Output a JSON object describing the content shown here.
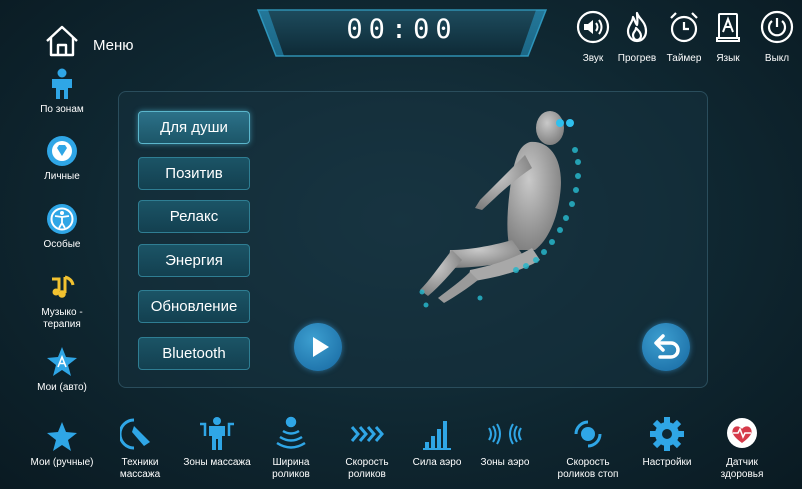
{
  "header": {
    "menu_label": "Меню",
    "timer": "00:00"
  },
  "top_tools": [
    {
      "label": "Звук",
      "icon": "speaker-icon"
    },
    {
      "label": "Прогрев",
      "icon": "flame-icon"
    },
    {
      "label": "Таймер",
      "icon": "alarm-clock-icon"
    },
    {
      "label": "Язык",
      "icon": "language-icon"
    },
    {
      "label": "Выкл",
      "icon": "power-icon"
    }
  ],
  "sidebar": {
    "items": [
      {
        "label": "По зонам",
        "icon": "body-zones-icon"
      },
      {
        "label": "Личные",
        "icon": "diamond-icon"
      },
      {
        "label": "Особые",
        "icon": "special-figure-icon"
      },
      {
        "label": "Музыко - терапия",
        "icon": "music-note-icon"
      },
      {
        "label": "Мои (авто)",
        "icon": "star-a-icon"
      },
      {
        "label": "Мои (ручные)",
        "icon": "star-icon"
      }
    ]
  },
  "modes": [
    {
      "label": "Для души",
      "active": true
    },
    {
      "label": "Позитив",
      "active": false
    },
    {
      "label": "Релакс",
      "active": false
    },
    {
      "label": "Энергия",
      "active": false
    },
    {
      "label": "Обновление",
      "active": false
    },
    {
      "label": "Bluetooth",
      "active": false
    }
  ],
  "bottom_tools": [
    {
      "label": "Техники массажа",
      "icon": "massage-technique-icon"
    },
    {
      "label": "Зоны массажа",
      "icon": "massage-zones-icon"
    },
    {
      "label": "Ширина роликов",
      "icon": "roller-width-icon"
    },
    {
      "label": "Скорость роликов",
      "icon": "roller-speed-icon"
    },
    {
      "label": "Сила аэро",
      "icon": "air-strength-icon"
    },
    {
      "label": "Зоны аэро",
      "icon": "air-zones-icon"
    },
    {
      "label": "Скорость роликов стоп",
      "icon": "foot-roller-speed-icon"
    },
    {
      "label": "Настройки",
      "icon": "gear-icon"
    },
    {
      "label": "Датчик здоровья",
      "icon": "heart-rate-icon"
    }
  ],
  "colors": {
    "accent": "#2fa6e6",
    "background": "#0f2731",
    "button": "#1b5466"
  }
}
